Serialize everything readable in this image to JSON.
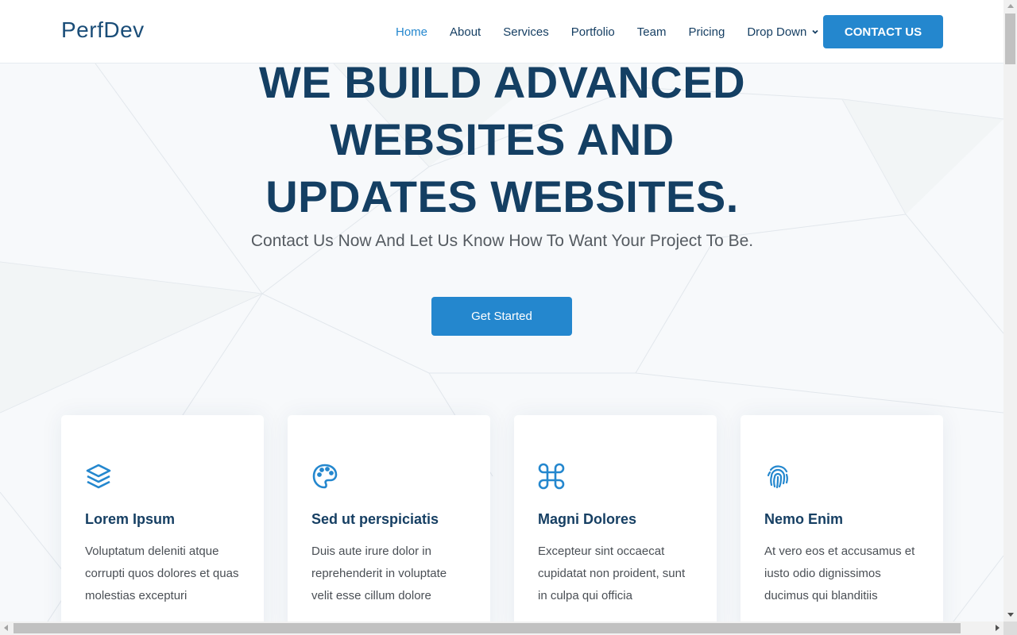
{
  "header": {
    "logo": "PerfDev",
    "nav": [
      {
        "label": "Home",
        "active": true
      },
      {
        "label": "About",
        "active": false
      },
      {
        "label": "Services",
        "active": false
      },
      {
        "label": "Portfolio",
        "active": false
      },
      {
        "label": "Team",
        "active": false
      },
      {
        "label": "Pricing",
        "active": false
      },
      {
        "label": "Drop Down",
        "active": false,
        "icon": "chevron-down-icon"
      }
    ],
    "cta_label": "CONTACT US"
  },
  "hero": {
    "title_lines": [
      "WE BUILD ADVANCED",
      "WEBSITES AND",
      "UPDATES WEBSITES."
    ],
    "subtitle": "Contact Us Now And Let Us Know How To Want Your Project To Be.",
    "button_label": "Get Started"
  },
  "cards": [
    {
      "icon": "layers-icon",
      "title": "Lorem Ipsum",
      "text": "Voluptatum deleniti atque corrupti quos dolores et quas molestias excepturi"
    },
    {
      "icon": "palette-icon",
      "title": "Sed ut perspiciatis",
      "text": "Duis aute irure dolor in reprehenderit in voluptate velit esse cillum dolore"
    },
    {
      "icon": "command-icon",
      "title": "Magni Dolores",
      "text": "Excepteur sint occaecat cupidatat non proident, sunt in culpa qui officia"
    },
    {
      "icon": "fingerprint-icon",
      "title": "Nemo Enim",
      "text": "At vero eos et accusamus et iusto odio dignissimos ducimus qui blanditiis"
    }
  ],
  "colors": {
    "accent": "#2487ce",
    "heading": "#143f63",
    "body_text": "#4a4f55",
    "background": "#f7f9fb"
  }
}
